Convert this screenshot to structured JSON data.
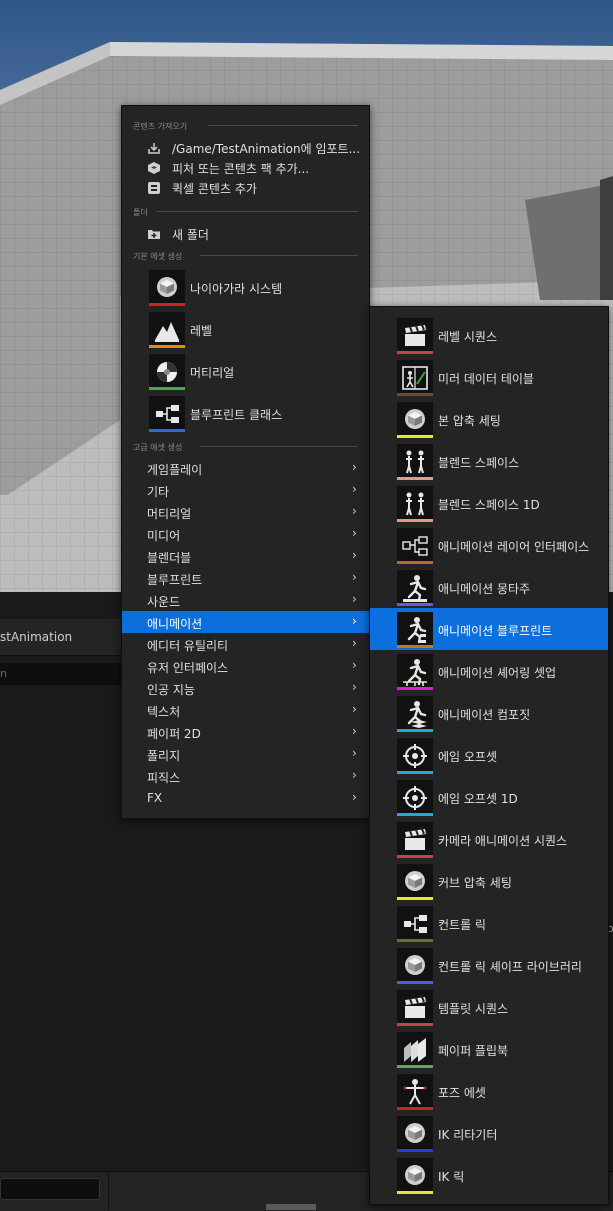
{
  "background": {
    "panel_tab_label": "stAnimation",
    "search_placeholder": "n",
    "right_mark": "o"
  },
  "menu": {
    "sections": {
      "import": "콘텐츠 가져오기",
      "folder": "폴더",
      "basic": "기본 에셋 생성",
      "advanced": "고급 에셋 생성"
    },
    "import_items": [
      {
        "label": "/Game/TestAnimation에 임포트...",
        "icon": "import-icon"
      },
      {
        "label": "피처 또는 콘텐츠 팩 추가...",
        "icon": "content-pack-icon"
      },
      {
        "label": "퀵셀 콘텐츠 추가",
        "icon": "quixel-icon"
      }
    ],
    "folder_items": [
      {
        "label": "새 폴더",
        "icon": "new-folder-icon"
      }
    ],
    "basic_assets": [
      {
        "label": "나이아가라 시스템",
        "icon": "niagara-icon",
        "color": "#d21f1f"
      },
      {
        "label": "레벨",
        "icon": "level-icon",
        "color": "#e88a15"
      },
      {
        "label": "머티리얼",
        "icon": "material-icon",
        "color": "#4aa83a"
      },
      {
        "label": "블루프린트 클래스",
        "icon": "blueprint-icon",
        "color": "#2e6bd1"
      }
    ],
    "categories": [
      "게임플레이",
      "기타",
      "머티리얼",
      "미디어",
      "블렌더블",
      "블루프린트",
      "사운드",
      "애니메이션",
      "에디터 유틸리티",
      "유저 인터페이스",
      "인공 지능",
      "텍스처",
      "페이퍼 2D",
      "폴리지",
      "피직스",
      "FX"
    ],
    "active_category": "애니메이션",
    "chevron": "›"
  },
  "submenu": {
    "active_item": "애니메이션 블루프린트",
    "items": [
      {
        "label": "레벨 시퀀스",
        "icon": "level-sequence-icon",
        "color": "#c44545"
      },
      {
        "label": "미러 데이터 테이블",
        "icon": "mirror-data-table-icon",
        "color": "#7a4a1e"
      },
      {
        "label": "본 압축 세팅",
        "icon": "bone-compression-icon",
        "color": "#e8e820"
      },
      {
        "label": "블렌드 스페이스",
        "icon": "blend-space-icon",
        "color": "#e59a82"
      },
      {
        "label": "블렌드 스페이스 1D",
        "icon": "blend-space-1d-icon",
        "color": "#e59a82"
      },
      {
        "label": "애니메이션 레이어 인터페이스",
        "icon": "anim-layer-interface-icon",
        "color": "#b86a2a"
      },
      {
        "label": "애니메이션 몽타주",
        "icon": "anim-montage-icon",
        "color": "#6a5acd"
      },
      {
        "label": "애니메이션 블루프린트",
        "icon": "anim-blueprint-icon",
        "color": "#c8761e"
      },
      {
        "label": "애니메이션 셰어링 셋업",
        "icon": "anim-sharing-setup-icon",
        "color": "#d81ed8"
      },
      {
        "label": "애니메이션 컴포짓",
        "icon": "anim-composite-icon",
        "color": "#2aa3d8"
      },
      {
        "label": "에임 오프셋",
        "icon": "aim-offset-icon",
        "color": "#2aa3d8"
      },
      {
        "label": "에임 오프셋 1D",
        "icon": "aim-offset-1d-icon",
        "color": "#2aa3d8"
      },
      {
        "label": "카메라 애니메이션 시퀀스",
        "icon": "camera-anim-sequence-icon",
        "color": "#c44545"
      },
      {
        "label": "커브 압축 세팅",
        "icon": "curve-compression-icon",
        "color": "#e8e820"
      },
      {
        "label": "컨트롤 릭",
        "icon": "control-rig-icon",
        "color": "#7a6a1e"
      },
      {
        "label": "컨트롤 릭 셰이프 라이브러리",
        "icon": "control-rig-shape-library-icon",
        "color": "#5a5ad8"
      },
      {
        "label": "템플릿 시퀀스",
        "icon": "template-sequence-icon",
        "color": "#c44545"
      },
      {
        "label": "페이퍼 플립북",
        "icon": "paper-flipbook-icon",
        "color": "#5aa85a"
      },
      {
        "label": "포즈 에셋",
        "icon": "pose-asset-icon",
        "color": "#d21f1f"
      },
      {
        "label": "IK 리타기터",
        "icon": "ik-retargeter-icon",
        "color": "#2a3ad8"
      },
      {
        "label": "IK 릭",
        "icon": "ik-rig-icon",
        "color": "#e8e820"
      }
    ]
  }
}
